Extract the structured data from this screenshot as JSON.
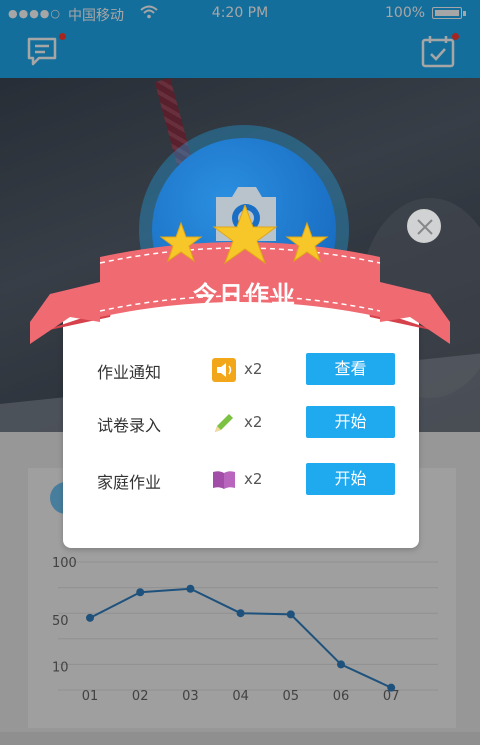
{
  "status_bar": {
    "signal": "●●●●○",
    "carrier": "中国移动",
    "time": "4:20 PM",
    "battery": "100%"
  },
  "nav": {
    "left_icon": "message-icon",
    "right_icon": "calendar-check-icon"
  },
  "modal": {
    "title": "今日作业",
    "rating_stars": 3,
    "items": [
      {
        "label": "作业通知",
        "icon": "speaker-icon",
        "count": "x2",
        "button": "查看"
      },
      {
        "label": "试卷录入",
        "icon": "pencil-icon",
        "count": "x2",
        "button": "开始"
      },
      {
        "label": "家庭作业",
        "icon": "book-icon",
        "count": "x2",
        "button": "开始"
      }
    ]
  },
  "chart_data": {
    "type": "line",
    "categories": [
      "01",
      "02",
      "03",
      "04",
      "05",
      "06",
      "07"
    ],
    "values": [
      52,
      74,
      77,
      56,
      55,
      12,
      -8
    ],
    "yticks": [
      100,
      50,
      10
    ],
    "ylim": [
      -10,
      100
    ],
    "color": "#2f7fc1"
  }
}
